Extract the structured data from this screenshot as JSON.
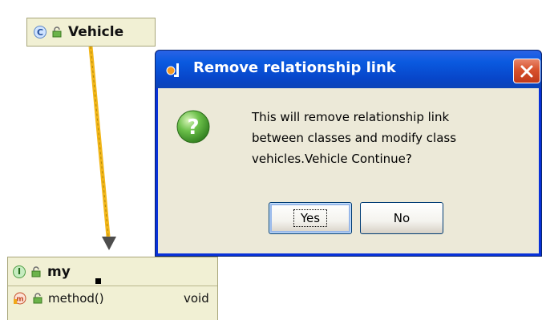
{
  "diagram": {
    "parent_class": {
      "kind_badge": "C",
      "name": "Vehicle"
    },
    "child_interface": {
      "kind_badge": "I",
      "name": "my",
      "members": [
        {
          "name": "method()",
          "return_type": "void"
        }
      ]
    },
    "link_color": "#f2b618",
    "arrow_color": "#4d4d4d"
  },
  "dialog": {
    "title": "Remove relationship link",
    "message_lines": [
      "This will remove relationship link",
      "between classes and modify class",
      "vehicles.Vehicle Continue?"
    ],
    "icon": "question-icon",
    "buttons": {
      "yes": "Yes",
      "no": "No"
    },
    "close_icon": "close-icon",
    "title_bar_color": "#0a5ae0",
    "close_button_color": "#d8522d"
  }
}
